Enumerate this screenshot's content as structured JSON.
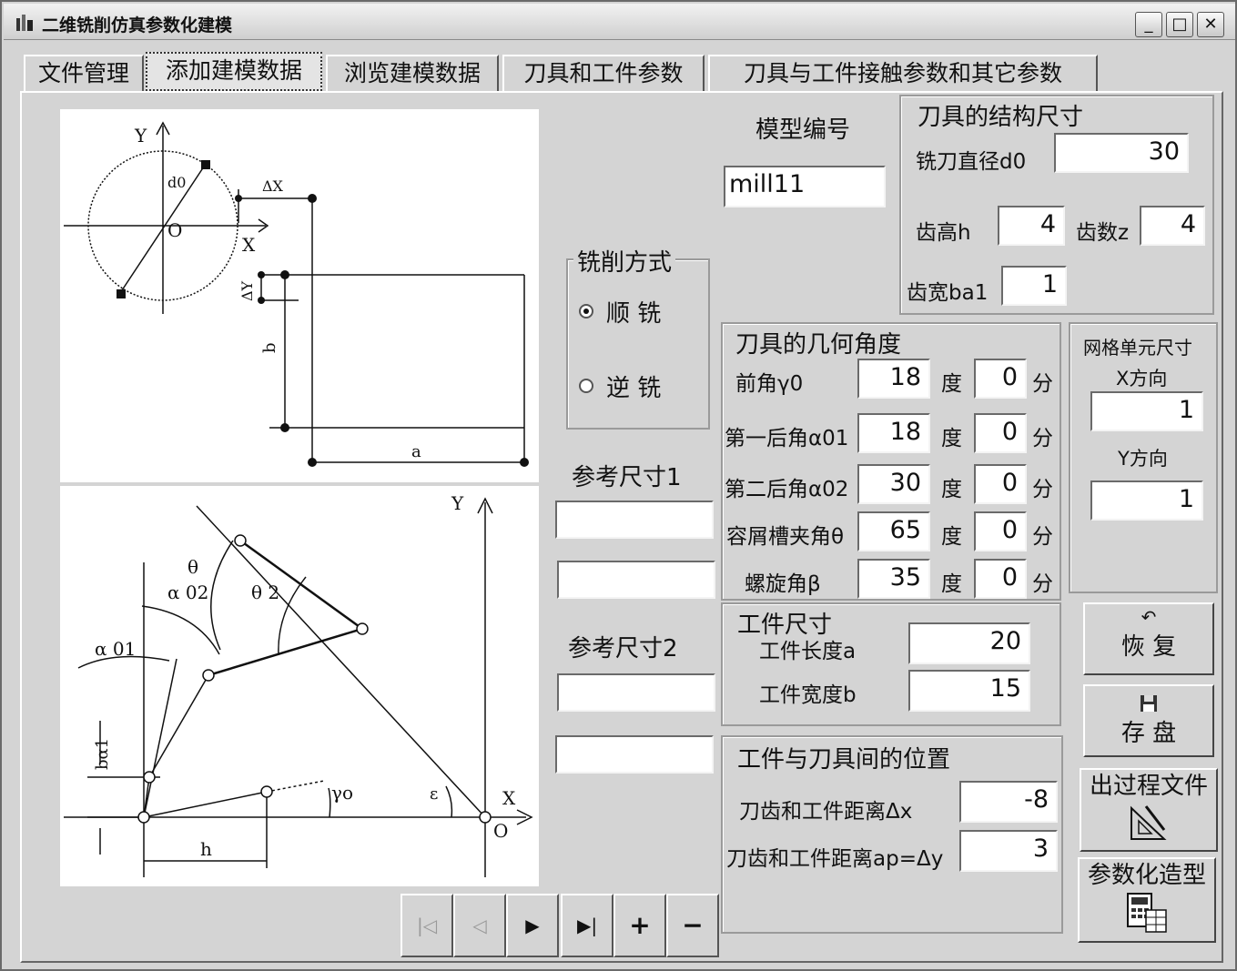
{
  "window": {
    "title": "二维铣削仿真参数化建模"
  },
  "tabs": [
    "文件管理",
    "添加建模数据",
    "浏览建模数据",
    "刀具和工件参数",
    "刀具与工件接触参数和其它参数"
  ],
  "model": {
    "label": "模型编号",
    "value": "mill11"
  },
  "milling_mode": {
    "title": "铣削方式",
    "options": [
      "顺 铣",
      "逆 铣"
    ],
    "selected": "顺 铣"
  },
  "ref1": {
    "label": "参考尺寸1",
    "values": [
      "",
      ""
    ]
  },
  "ref2": {
    "label": "参考尺寸2",
    "values": [
      "",
      ""
    ]
  },
  "tool_struct": {
    "title": "刀具的结构尺寸",
    "diameter_label": "铣刀直径d0",
    "diameter": "30",
    "tooth_height_label": "齿高h",
    "tooth_height": "4",
    "tooth_count_label": "齿数z",
    "tooth_count": "4",
    "tooth_width_label": "齿宽ba1",
    "tooth_width": "1"
  },
  "tool_angles": {
    "title": "刀具的几何角度",
    "deg_unit": "度",
    "min_unit": "分",
    "rows": [
      {
        "label": "前角γ0",
        "deg": "18",
        "min": "0"
      },
      {
        "label": "第一后角α01",
        "deg": "18",
        "min": "0"
      },
      {
        "label": "第二后角α02",
        "deg": "30",
        "min": "0"
      },
      {
        "label": "容屑槽夹角θ",
        "deg": "65",
        "min": "0"
      },
      {
        "label": "螺旋角β",
        "deg": "35",
        "min": "0"
      }
    ]
  },
  "mesh": {
    "title": "网格单元尺寸",
    "x_label": "X方向",
    "x": "1",
    "y_label": "Y方向",
    "y": "1"
  },
  "workpiece": {
    "title": "工件尺寸",
    "length_label": "工件长度a",
    "length": "20",
    "width_label": "工件宽度b",
    "width": "15"
  },
  "position": {
    "title": "工件与刀具间的位置",
    "dx_label": "刀齿和工件距离Δx",
    "dx": "-8",
    "dy_label": "刀齿和工件距离ap=Δy",
    "dy": "3"
  },
  "buttons": {
    "restore": "恢 复",
    "save": "存 盘",
    "export": "出过程文件",
    "parametric": "参数化造型"
  },
  "nav": {
    "first": "|◁",
    "prev": "◁",
    "next": "▶",
    "last": "▶|",
    "add": "+",
    "remove": "−"
  },
  "diagram1_labels": {
    "y": "Y",
    "x": "X",
    "o": "O",
    "d0": "d0",
    "dx": "ΔX",
    "dy": "ΔY",
    "b": "b",
    "a": "a"
  },
  "diagram2_labels": {
    "y": "Y",
    "x": "X",
    "o": "O",
    "theta": "θ",
    "theta2": "θ 2",
    "a02": "α 02",
    "a01": "α 01",
    "ba1": "bα1",
    "h": "h",
    "gamma0": "γo",
    "eps": "ε"
  }
}
